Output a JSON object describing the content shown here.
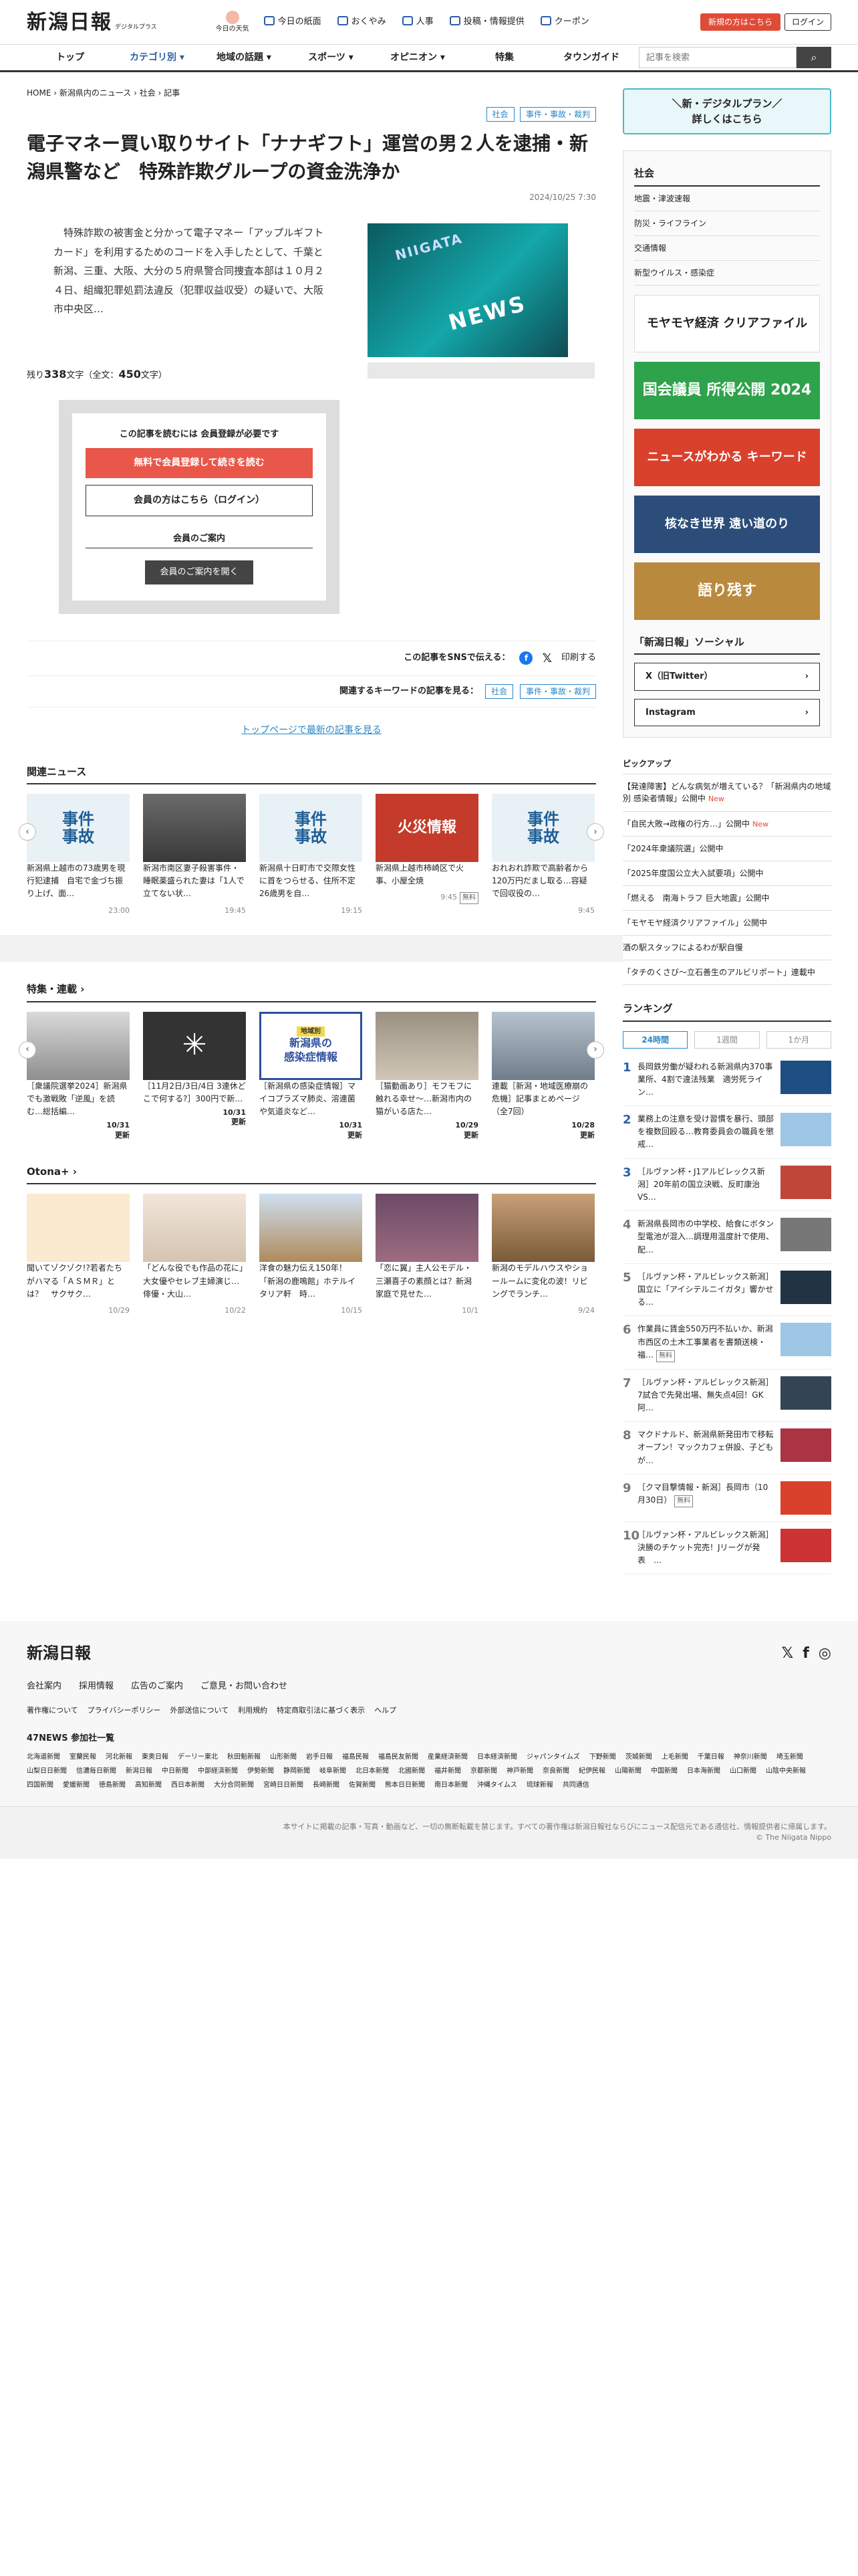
{
  "header": {
    "logo": "新潟日報",
    "logo_sub": "デジタルプラス",
    "today_label": "今日の天気",
    "nav": [
      "今日の紙面",
      "おくやみ",
      "人事",
      "投稿・情報提供",
      "クーポン"
    ],
    "register": "新規の方はこちら",
    "login": "ログイン"
  },
  "gnav": {
    "items": [
      "トップ",
      "カテゴリ別",
      "地域の話題",
      "スポーツ",
      "オピニオン",
      "特集",
      "タウンガイド"
    ],
    "search_placeholder": "記事を検索"
  },
  "article": {
    "breadcrumb": [
      "HOME",
      "新潟県内のニュース",
      "社会",
      "記事"
    ],
    "tags": [
      "社会",
      "事件・事故・裁判"
    ],
    "title": "電子マネー買い取りサイト「ナナギフト」運営の男２人を逮捕・新潟県警など　特殊詐欺グループの資金洗浄か",
    "date": "2024/10/25 7:30",
    "lead": "　特殊詐欺の被害金と分かって電子マネー「アップルギフトカード」を利用するためのコードを入手したとして、千葉と新潟、三重、大阪、大分の５府県警合同捜査本部は１０月２４日、組織犯罪処罰法違反（犯罪収益収受）の疑いで、大阪市中央区…",
    "image_text_top": "NIIGATA",
    "image_text_main": "NEWS",
    "remain_label": "残り",
    "remain": "338",
    "remain_unit": "文字（全文：",
    "total": "450",
    "total_unit": "文字）"
  },
  "paywall": {
    "note": "この記事を読むには 会員登録が必要です",
    "register": "無料で会員登録して続きを読む",
    "login": "会員の方はこちら（ログイン）",
    "guide_title": "会員のご案内",
    "guide_btn": "会員のご案内を開く"
  },
  "share": {
    "label": "この記事をSNSで伝える：",
    "fb": "f",
    "x": "𝕏",
    "print": "印刷する"
  },
  "keywords": {
    "label": "関連するキーワードの記事を見る：",
    "items": [
      "社会",
      "事件・事故・裁判"
    ]
  },
  "toplink": "トップページで最新の記事を見る",
  "related": {
    "heading": "関連ニュース",
    "items": [
      {
        "thumb": "事件\n事故",
        "title": "新潟県上越市の73歳男を現行犯逮捕　自宅で金づち振り上げ、面…",
        "time": "23:00",
        "free": false
      },
      {
        "thumb": "",
        "title": "新潟市南区妻子殺害事件・睡眠薬盛られた妻は「1人で立てない状…",
        "time": "19:45",
        "free": false
      },
      {
        "thumb": "事件\n事故",
        "title": "新潟県十日町市で交際女性に首をつらせる、住所不定26歳男を自…",
        "time": "19:15",
        "free": false
      },
      {
        "thumb": "火災情報",
        "title": "新潟県上越市柿崎区で火事、小屋全焼",
        "time": "9:45",
        "free": true
      },
      {
        "thumb": "事件\n事故",
        "title": "おれおれ詐欺で高齢者から120万円だまし取る…容疑で回収役の…",
        "time": "9:45",
        "free": false
      }
    ],
    "free_label": "無料"
  },
  "features": {
    "heading": "特集・連載",
    "items": [
      {
        "title": "［衆議院選挙2024］新潟県でも激戦敗「逆風」を読む…総括編…",
        "date": "10/31",
        "upd": "更新"
      },
      {
        "title": "［11月2日/3日/4日 3連休どこで何する?］300円で新…",
        "date": "10/31",
        "upd": "更新"
      },
      {
        "title": "［新潟県の感染症情報］マイコプラズマ肺炎、溶連菌や気道炎など…",
        "date": "10/31",
        "upd": "更新",
        "thumb": "新潟県の\n感染症情報",
        "thumb_tag": "地域別"
      },
      {
        "title": "［猫動画あり］モフモフに触れる幸せ〜…新潟市内の猫がいる店た…",
        "date": "10/29",
        "upd": "更新"
      },
      {
        "title": "連載［新潟・地域医療崩の危機］記事まとめページ（全7回）",
        "date": "10/28",
        "upd": "更新"
      }
    ]
  },
  "otona": {
    "heading": "Otona+",
    "items": [
      {
        "title": "聞いてゾクゾク!?若者たちがハマる「ＡＳＭＲ」とは？　サクサク…",
        "date": "10/29"
      },
      {
        "title": "「どんな役でも作品の花に」大女優やセレブ主婦演じ…俳優・大山…",
        "date": "10/22"
      },
      {
        "title": "洋食の魅力伝え150年！「新潟の鹿鳴館」ホテルイタリア軒　時…",
        "date": "10/15"
      },
      {
        "title": "「恋に翼」主人公モデル・三瀬喜子の素顔とは？新潟家庭で見せた…",
        "date": "10/1"
      },
      {
        "title": "新潟のモデルハウスやショールームに変化の波！リビングでランチ…",
        "date": "9/24"
      }
    ]
  },
  "side": {
    "promo": "＼新・デジタルプラン／\n詳しくはこちら",
    "social_heading": "社会",
    "social_list": [
      "地震・津波速報",
      "防災・ライフライン",
      "交通情報",
      "新型ウイルス・感染症"
    ],
    "banners": [
      "モヤモヤ経済 クリアファイル",
      "国会議員 所得公開 2024",
      "ニュースがわかる キーワード",
      "核なき世界 遠い道のり",
      "語り残す"
    ],
    "sns_heading": "「新潟日報」ソーシャル",
    "sns": [
      "X（旧Twitter）",
      "Instagram"
    ],
    "pickup_heading": "ピックアップ",
    "pickup": [
      {
        "text": "【発達障害】どんな病気が増えている？「新潟県内の地域別 感染者情報」公開中",
        "new": true
      },
      {
        "text": "「自民大敗→政権の行方…」公開中",
        "new": true
      },
      {
        "text": "「2024年衆議院選」公開中",
        "new": false
      },
      {
        "text": "「2025年度国公立大入試要項」公開中",
        "new": false
      },
      {
        "text": "「燃える　南海トラフ 巨大地震」公開中",
        "new": false
      },
      {
        "text": "「モヤモヤ経済クリアファイル」公開中",
        "new": false
      },
      {
        "text": "酒の駅スタッフによるわが駅自慢",
        "new": false
      },
      {
        "text": "「タチのくさび〜立石善生のアルビリポート」連載中",
        "new": false
      }
    ],
    "new_label": "New",
    "ranking_heading": "ランキング",
    "ranking_tabs": [
      "24時間",
      "1週間",
      "1か月"
    ],
    "ranking": [
      {
        "no": "1",
        "text": "長岡鉄労働が疑われる新潟県内370事業所、4割で違法残業　適労死ライン…"
      },
      {
        "no": "2",
        "text": "業務上の注意を受け習慣を暴行、頭部を複数回殴る…教育委員会の職員を懲戒…"
      },
      {
        "no": "3",
        "text": "［ルヴァン杯・J1アルビレックス新潟］20年前の国立決戦、反町康治VS…"
      },
      {
        "no": "4",
        "text": "新潟県長岡市の中学校、給食にボタン型電池が混入…調理用温度計で使用、配…"
      },
      {
        "no": "5",
        "text": "［ルヴァン杯・アルビレックス新潟］国立に「アイシテルニイガタ」響かせる…"
      },
      {
        "no": "6",
        "text": "作業員に賃金550万円不払いか、新潟市西区の土木工事業者を書類送検・福…",
        "free": true
      },
      {
        "no": "7",
        "text": "［ルヴァン杯・アルビレックス新潟］7試合で先発出場、無失点4回！GK阿…"
      },
      {
        "no": "8",
        "text": "マクドナルド、新潟県新発田市で移転オープン！マックカフェ併設、子どもが…"
      },
      {
        "no": "9",
        "text": "［クマ目撃情報・新潟］長岡市（10月30日）",
        "free": true
      },
      {
        "no": "10",
        "text": "［ルヴァン杯・アルビレックス新潟］決勝のチケット完売！Jリーグが発表　…"
      }
    ],
    "free_label": "無料"
  },
  "footer": {
    "logo": "新潟日報",
    "links": [
      "会社案内",
      "採用情報",
      "広告のご案内",
      "ご意見・お問い合わせ"
    ],
    "links2": [
      "著作権について",
      "プライバシーポリシー",
      "外部送信について",
      "利用規約",
      "特定商取引法に基づく表示",
      "ヘルプ"
    ],
    "p47": "47NEWS 参加社一覧",
    "papers": [
      "北海道新聞",
      "室蘭民報",
      "河北新報",
      "東奥日報",
      "デーリー東北",
      "秋田魁新報",
      "山形新聞",
      "岩手日報",
      "福島民報",
      "福島民友新聞",
      "産業経済新聞",
      "日本経済新聞",
      "ジャパンタイムズ",
      "下野新聞",
      "茨城新聞",
      "上毛新聞",
      "千葉日報",
      "神奈川新聞",
      "埼玉新聞",
      "山梨日日新聞",
      "信濃毎日新聞",
      "新潟日報",
      "中日新聞",
      "中部経済新聞",
      "伊勢新聞",
      "静岡新聞",
      "岐阜新聞",
      "北日本新聞",
      "北國新聞",
      "福井新聞",
      "京都新聞",
      "神戸新聞",
      "奈良新聞",
      "紀伊民報",
      "山陽新聞",
      "中国新聞",
      "日本海新聞",
      "山口新聞",
      "山陰中央新報",
      "四国新聞",
      "愛媛新聞",
      "徳島新聞",
      "高知新聞",
      "西日本新聞",
      "大分合同新聞",
      "宮崎日日新聞",
      "長崎新聞",
      "佐賀新聞",
      "熊本日日新聞",
      "南日本新聞",
      "沖縄タイムス",
      "琉球新報",
      "共同通信"
    ],
    "copyright": "本サイトに掲載の記事・写真・動画など、一切の無断転載を禁じます。すべての著作権は新潟日報社ならびにニュース配信元である通信社、情報提供者に帰属します。",
    "copyright2": "© The Niigata Nippo"
  }
}
